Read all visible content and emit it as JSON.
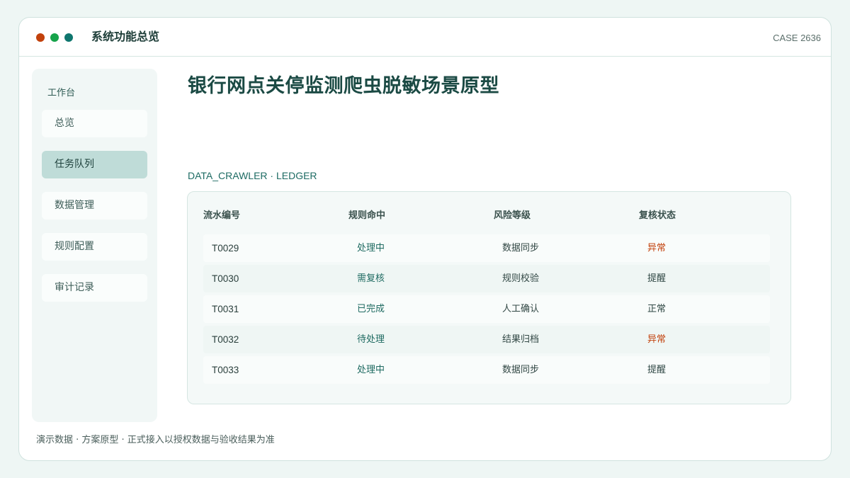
{
  "window": {
    "title": "系统功能总览",
    "case_id": "CASE 2636"
  },
  "sidebar": {
    "heading": "工作台",
    "items": [
      {
        "label": "总览",
        "active": false
      },
      {
        "label": "任务队列",
        "active": true
      },
      {
        "label": "数据管理",
        "active": false
      },
      {
        "label": "规则配置",
        "active": false
      },
      {
        "label": "审计记录",
        "active": false
      }
    ]
  },
  "main": {
    "title": "银行网点关停监测爬虫脱敏场景原型",
    "section_label": "DATA_CRAWLER · LEDGER",
    "table": {
      "headers": [
        "流水编号",
        "规则命中",
        "风险等级",
        "复核状态"
      ],
      "rows": [
        {
          "id": "T0029",
          "rule": "处理中",
          "risk": "数据同步",
          "status": "异常"
        },
        {
          "id": "T0030",
          "rule": "需复核",
          "risk": "规则校验",
          "status": "提醒"
        },
        {
          "id": "T0031",
          "rule": "已完成",
          "risk": "人工确认",
          "status": "正常"
        },
        {
          "id": "T0032",
          "rule": "待处理",
          "risk": "结果归档",
          "status": "异常"
        },
        {
          "id": "T0033",
          "rule": "处理中",
          "risk": "数据同步",
          "status": "提醒"
        }
      ]
    }
  },
  "footer": {
    "note": "演示数据 · 方案原型 · 正式接入以授权数据与验收结果为准"
  },
  "colors": {
    "accent": "#1b4a44",
    "status_alert": "#c2410c",
    "status_normal": "#2f4744",
    "traffic_red": "#c2410c",
    "traffic_green": "#16a34a",
    "traffic_teal": "#0f766e"
  }
}
